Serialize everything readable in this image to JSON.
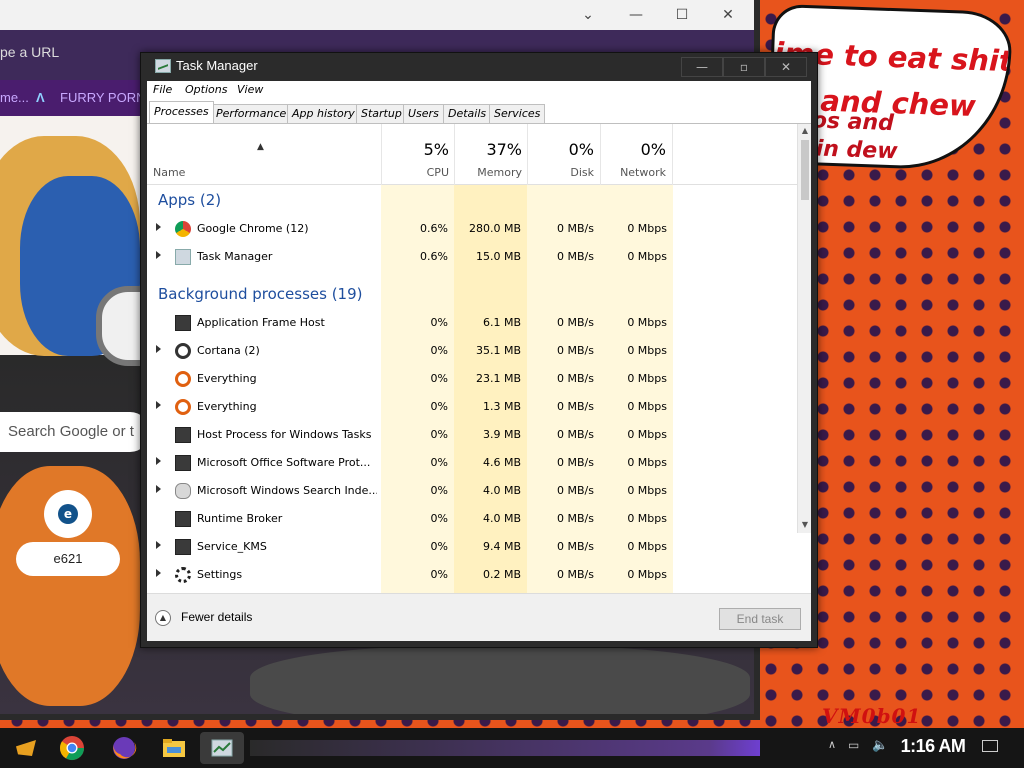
{
  "wallpaper": {
    "bubble_line1": "ime to eat shit",
    "bubble_line2": "and chew",
    "bubble_line3": "os and",
    "bubble_line4": "ain dew",
    "signature": "VM0b01"
  },
  "browser": {
    "address_text": "pe a URL",
    "bookmarks": [
      "me...",
      "FURRY PORN"
    ],
    "search_placeholder": "Search Google or t",
    "shortcut_label": "e621",
    "shortcut_glyph": "e"
  },
  "taskmgr": {
    "title": "Task Manager",
    "menu": [
      "File",
      "Options",
      "View"
    ],
    "tabs": [
      "Processes",
      "Performance",
      "App history",
      "Startup",
      "Users",
      "Details",
      "Services"
    ],
    "active_tab": "Processes",
    "columns": {
      "name": "Name",
      "cpu": {
        "pct": "5%",
        "label": "CPU"
      },
      "memory": {
        "pct": "37%",
        "label": "Memory"
      },
      "disk": {
        "pct": "0%",
        "label": "Disk"
      },
      "network": {
        "pct": "0%",
        "label": "Network"
      }
    },
    "groups": {
      "apps": "Apps (2)",
      "background": "Background processes (19)"
    },
    "apps": [
      {
        "name": "Google Chrome (12)",
        "cpu": "0.6%",
        "memory": "280.0 MB",
        "disk": "0 MB/s",
        "network": "0 Mbps",
        "expandable": true,
        "icon": "chrome-icon"
      },
      {
        "name": "Task Manager",
        "cpu": "0.6%",
        "memory": "15.0 MB",
        "disk": "0 MB/s",
        "network": "0 Mbps",
        "expandable": true,
        "icon": "task-manager-icon"
      }
    ],
    "background": [
      {
        "name": "Application Frame Host",
        "cpu": "0%",
        "memory": "6.1 MB",
        "disk": "0 MB/s",
        "network": "0 Mbps",
        "expandable": false,
        "icon": "app-window-icon"
      },
      {
        "name": "Cortana (2)",
        "cpu": "0%",
        "memory": "35.1 MB",
        "disk": "0 MB/s",
        "network": "0 Mbps",
        "expandable": true,
        "icon": "cortana-icon"
      },
      {
        "name": "Everything",
        "cpu": "0%",
        "memory": "23.1 MB",
        "disk": "0 MB/s",
        "network": "0 Mbps",
        "expandable": false,
        "icon": "magnifier-icon"
      },
      {
        "name": "Everything",
        "cpu": "0%",
        "memory": "1.3 MB",
        "disk": "0 MB/s",
        "network": "0 Mbps",
        "expandable": true,
        "icon": "magnifier-icon"
      },
      {
        "name": "Host Process for Windows Tasks",
        "cpu": "0%",
        "memory": "3.9 MB",
        "disk": "0 MB/s",
        "network": "0 Mbps",
        "expandable": false,
        "icon": "app-window-icon"
      },
      {
        "name": "Microsoft Office Software Prot...",
        "cpu": "0%",
        "memory": "4.6 MB",
        "disk": "0 MB/s",
        "network": "0 Mbps",
        "expandable": true,
        "icon": "app-window-icon"
      },
      {
        "name": "Microsoft Windows Search Inde...",
        "cpu": "0%",
        "memory": "4.0 MB",
        "disk": "0 MB/s",
        "network": "0 Mbps",
        "expandable": true,
        "icon": "search-indexer-icon"
      },
      {
        "name": "Runtime Broker",
        "cpu": "0%",
        "memory": "4.0 MB",
        "disk": "0 MB/s",
        "network": "0 Mbps",
        "expandable": false,
        "icon": "app-window-icon"
      },
      {
        "name": "Service_KMS",
        "cpu": "0%",
        "memory": "9.4 MB",
        "disk": "0 MB/s",
        "network": "0 Mbps",
        "expandable": true,
        "icon": "app-window-icon"
      },
      {
        "name": "Settings",
        "cpu": "0%",
        "memory": "0.2 MB",
        "disk": "0 MB/s",
        "network": "0 Mbps",
        "expandable": true,
        "icon": "gear-icon"
      }
    ],
    "footer": {
      "fewer_details": "Fewer details",
      "end_task": "End task"
    }
  },
  "taskbar": {
    "clock": "1:16 AM"
  },
  "colors": {
    "heat_light": "#fff8dc",
    "heat_mid": "#fff1c0",
    "heat_strong": "#ffe49a",
    "group_text": "#1e4e9e",
    "wallpaper_orange": "#e8541c"
  }
}
